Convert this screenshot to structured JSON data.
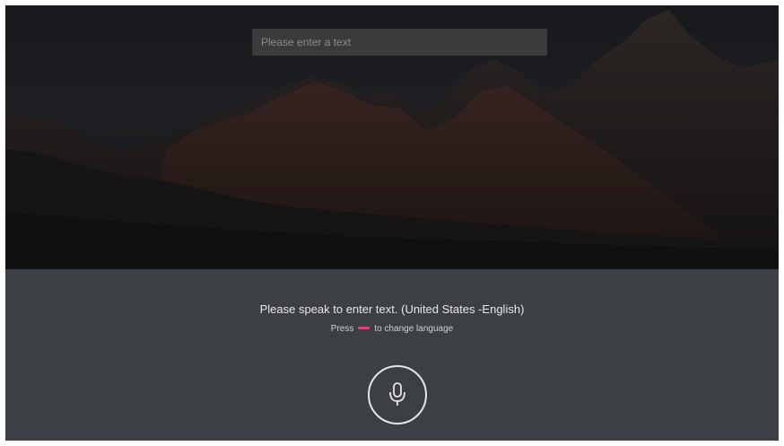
{
  "search": {
    "placeholder": "Please enter a text"
  },
  "voice": {
    "prompt": "Please speak to enter text. (United States -English)",
    "hint_before": "Press",
    "hint_after": "to change language"
  },
  "icons": {
    "close": "close-icon",
    "microphone": "microphone-icon",
    "language_key": "red-button-icon"
  },
  "colors": {
    "panel": "#3c3f43",
    "red_key": "#e0457a",
    "text": "#e8e8e8"
  }
}
